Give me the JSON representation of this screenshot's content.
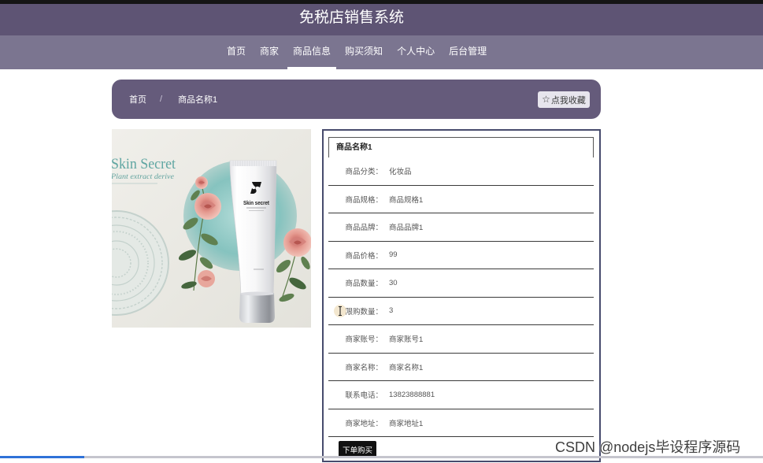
{
  "app": {
    "title": "免税店销售系统"
  },
  "nav": {
    "items": [
      {
        "label": "首页",
        "active": false
      },
      {
        "label": "商家",
        "active": false
      },
      {
        "label": "商品信息",
        "active": true
      },
      {
        "label": "购买须知",
        "active": false
      },
      {
        "label": "个人中心",
        "active": false
      },
      {
        "label": "后台管理",
        "active": false
      }
    ]
  },
  "breadcrumb": {
    "items": [
      "首页",
      "商品名称1"
    ],
    "separator": "/"
  },
  "favorite_button": {
    "icon": "star-outline-icon",
    "label": "点我收藏"
  },
  "product_image": {
    "headline": "Skin Secret",
    "tagline": "Plant extract derive",
    "tube_brand": "Skin secret"
  },
  "details": {
    "title": "商品名称1",
    "rows": [
      {
        "label": "商品分类：",
        "value": "化妆品"
      },
      {
        "label": "商品规格：",
        "value": "商品规格1"
      },
      {
        "label": "商品品牌：",
        "value": "商品品牌1"
      },
      {
        "label": "商品价格：",
        "value": "99"
      },
      {
        "label": "商品数量：",
        "value": "30"
      },
      {
        "label": "限购数量：",
        "value": "3"
      },
      {
        "label": "商家账号：",
        "value": "商家账号1"
      },
      {
        "label": "商家名称：",
        "value": "商家名称1"
      },
      {
        "label": "联系电话：",
        "value": "13823888881"
      },
      {
        "label": "商家地址：",
        "value": "商家地址1"
      }
    ]
  },
  "order_button": {
    "label": "下单购买"
  },
  "cursor": {
    "icon": "text-cursor-icon"
  },
  "playback_progress": 0.11,
  "watermark": "CSDN @nodejs毕设程序源码",
  "colors": {
    "header_bg": "#5e5474",
    "nav_bg": "#7b7590",
    "breadcrumb_bg": "#655b7b",
    "panel_border": "#474b6d",
    "order_button_bg": "#111111",
    "progress_fill": "#2f72d8"
  }
}
